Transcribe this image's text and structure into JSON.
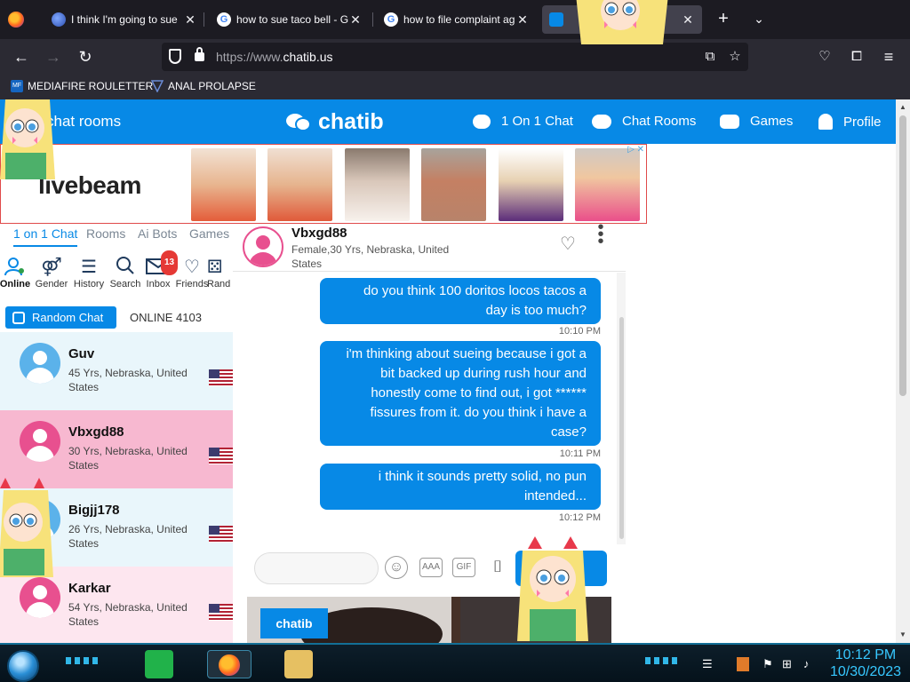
{
  "browser": {
    "tabs": [
      {
        "title": "I think I'm going to sue",
        "favicon": "globe-icon",
        "active": false
      },
      {
        "title": "how to sue taco bell - Go",
        "favicon": "google-icon",
        "active": false
      },
      {
        "title": "how to file complaint ag",
        "favicon": "google-icon",
        "active": false
      },
      {
        "title": "",
        "favicon": "chatib-icon",
        "active": true
      }
    ],
    "url_dim": "https://www.",
    "url_host": "chatib.us",
    "bookmarks": [
      "MEDIAFIRE ROULETTER",
      "ANAL PROLAPSE"
    ],
    "bookmark_icon_text": "MF"
  },
  "site": {
    "header": {
      "rooms_left": "chat rooms",
      "logo": "chatib",
      "nav": [
        "1 On 1 Chat",
        "Chat Rooms",
        "Games",
        "Profile"
      ]
    },
    "ad": {
      "brand": "livebeam"
    },
    "left_tabs": [
      "1 on 1 Chat",
      "Rooms",
      "Ai Bots",
      "Games"
    ],
    "icon_row": [
      {
        "label": "Online",
        "icon": "online-user-icon"
      },
      {
        "label": "Gender",
        "icon": "gender-icon"
      },
      {
        "label": "History",
        "icon": "history-list-icon"
      },
      {
        "label": "Search",
        "icon": "search-icon"
      },
      {
        "label": "Inbox",
        "icon": "inbox-envelope-icon",
        "badge": "13"
      },
      {
        "label": "Friends",
        "icon": "heart-icon"
      },
      {
        "label": "Rand",
        "icon": "dice-icon"
      }
    ],
    "random_chat": "Random Chat",
    "online_count": "ONLINE 4103",
    "users": [
      {
        "name": "Guv",
        "meta": "45 Yrs, Nebraska, United States",
        "gender": "male"
      },
      {
        "name": "Vbxgd88",
        "meta": "30 Yrs, Nebraska, United States",
        "gender": "female",
        "selected": true
      },
      {
        "name": "Bigjj178",
        "meta": "26 Yrs, Nebraska, United States",
        "gender": "male"
      },
      {
        "name": "Karkar",
        "meta": "54 Yrs, Nebraska, United States",
        "gender": "female"
      }
    ],
    "chat": {
      "partner_name": "Vbxgd88",
      "partner_meta": "Female,30 Yrs, Nebraska, United States",
      "messages": [
        {
          "text": "do you think 100 doritos locos tacos a day is too much?",
          "time": "10:10 PM"
        },
        {
          "text": "i'm thinking about sueing because i got a bit backed up during rush hour and honestly come to find out, i got ****** fissures from it. do you think i have a case?",
          "time": "10:11 PM"
        },
        {
          "text": "i think it sounds pretty solid, no pun intended...",
          "time": "10:12 PM"
        }
      ],
      "input_value": "",
      "btn_aaa": "AAA",
      "btn_gif": "GIF"
    },
    "video_badge": "chatib"
  },
  "taskbar": {
    "time": "10:12 PM",
    "date": "10/30/2023"
  },
  "colors": {
    "brand_blue": "#0789e6",
    "selected_row": "#f7b8d0",
    "alt_row": "#e9f6fb",
    "ad_border": "#e04a4a"
  }
}
